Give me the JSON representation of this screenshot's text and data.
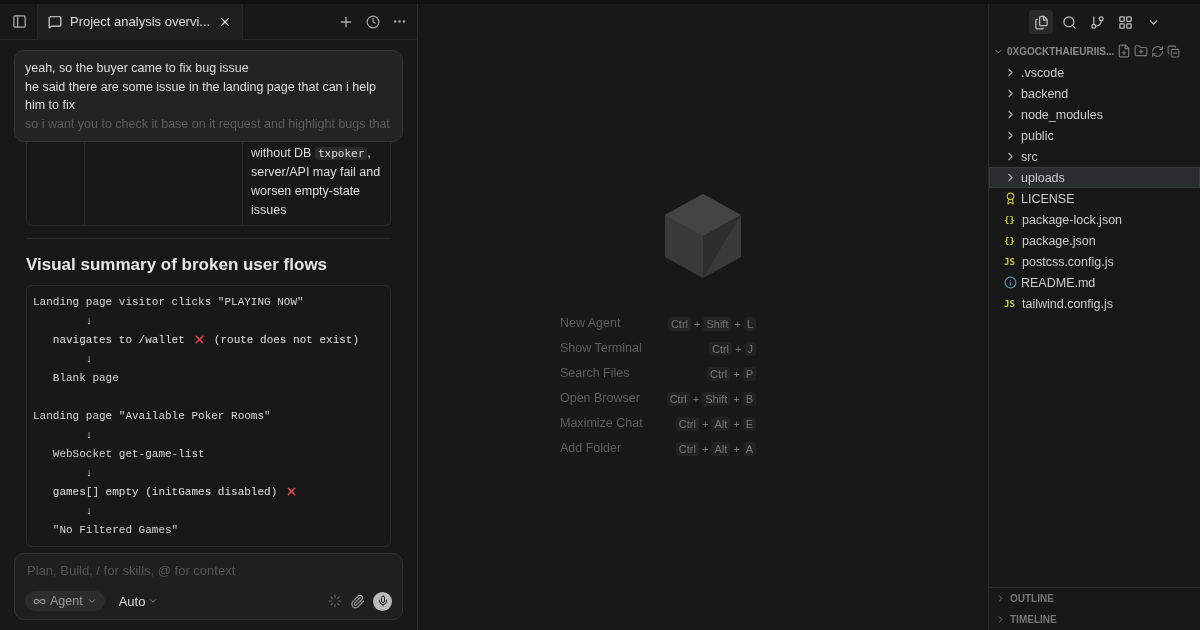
{
  "chat_tab": {
    "title": "Project analysis overvi..."
  },
  "user_message": {
    "lines": [
      "yeah, so the buyer came to fix bug issue",
      "he said there are some issue in the landing page that can i help him to fix",
      "so i want you to check it base on it request and highlight bugs that"
    ]
  },
  "table_fragment": {
    "cell_before": "without DB",
    "code": "txpoker",
    "cell_after": ", server/API may fail and worsen empty-state issues"
  },
  "section_heading": "Visual summary of broken user flows",
  "code_block": {
    "lines": [
      {
        "text": "Landing page visitor clicks \"PLAYING NOW\"",
        "error": false
      },
      {
        "text": "        ↓",
        "error": false
      },
      {
        "text": "   navigates to /wallet",
        "error": true,
        "note": "(route does not exist)"
      },
      {
        "text": "        ↓",
        "error": false
      },
      {
        "text": "   Blank page",
        "error": false
      },
      {
        "error": false
      },
      {
        "text": "Landing page \"Available Poker Rooms\"",
        "error": false
      },
      {
        "text": "        ↓",
        "error": false
      },
      {
        "text": "   WebSocket get-game-list",
        "error": false
      },
      {
        "text": "        ↓",
        "error": false
      },
      {
        "text": "   games[] empty (initGames disabled)",
        "error": true
      },
      {
        "text": "        ↓",
        "error": false
      },
      {
        "text": "   \"No Filtered Games\"",
        "error": false
      }
    ]
  },
  "composer": {
    "placeholder": "Plan, Build, / for skills, @ for context",
    "mode": "Agent",
    "model": "Auto"
  },
  "shortcuts": [
    {
      "label": "New Agent",
      "keys": [
        {
          "kind": "key",
          "text": "Ctrl"
        },
        {
          "kind": "plus",
          "text": "+"
        },
        {
          "kind": "key",
          "text": "Shift"
        },
        {
          "kind": "plus",
          "text": "+"
        },
        {
          "kind": "key",
          "text": "L"
        }
      ]
    },
    {
      "label": "Show Terminal",
      "keys": [
        {
          "kind": "key",
          "text": "Ctrl"
        },
        {
          "kind": "plus",
          "text": "+"
        },
        {
          "kind": "key",
          "text": "J"
        }
      ]
    },
    {
      "label": "Search Files",
      "keys": [
        {
          "kind": "key",
          "text": "Ctrl"
        },
        {
          "kind": "plus",
          "text": "+"
        },
        {
          "kind": "key",
          "text": "P"
        }
      ]
    },
    {
      "label": "Open Browser",
      "keys": [
        {
          "kind": "key",
          "text": "Ctrl"
        },
        {
          "kind": "plus",
          "text": "+"
        },
        {
          "kind": "key",
          "text": "Shift"
        },
        {
          "kind": "plus",
          "text": "+"
        },
        {
          "kind": "key",
          "text": "B"
        }
      ]
    },
    {
      "label": "Maximize Chat",
      "keys": [
        {
          "kind": "key",
          "text": "Ctrl"
        },
        {
          "kind": "plus",
          "text": "+"
        },
        {
          "kind": "key",
          "text": "Alt"
        },
        {
          "kind": "plus",
          "text": "+"
        },
        {
          "kind": "key",
          "text": "E"
        }
      ]
    },
    {
      "label": "Add Folder",
      "keys": [
        {
          "kind": "key",
          "text": "Ctrl"
        },
        {
          "kind": "plus",
          "text": "+"
        },
        {
          "kind": "key",
          "text": "Alt"
        },
        {
          "kind": "plus",
          "text": "+"
        },
        {
          "kind": "key",
          "text": "A"
        }
      ]
    }
  ],
  "explorer": {
    "root": "0XGOCKTHAIEURIIS...",
    "items": [
      {
        "name": ".vscode",
        "kind": "folder",
        "selected": false
      },
      {
        "name": "backend",
        "kind": "folder",
        "selected": false
      },
      {
        "name": "node_modules",
        "kind": "folder",
        "selected": false
      },
      {
        "name": "public",
        "kind": "folder",
        "selected": false
      },
      {
        "name": "src",
        "kind": "folder",
        "selected": false
      },
      {
        "name": "uploads",
        "kind": "folder",
        "selected": true
      },
      {
        "name": "LICENSE",
        "kind": "license",
        "selected": false
      },
      {
        "name": "package-lock.json",
        "kind": "json",
        "icon_text": "{}",
        "selected": false
      },
      {
        "name": "package.json",
        "kind": "json",
        "icon_text": "{}",
        "selected": false
      },
      {
        "name": "postcss.config.js",
        "kind": "js",
        "icon_text": "JS",
        "selected": false
      },
      {
        "name": "README.md",
        "kind": "info",
        "selected": false
      },
      {
        "name": "tailwind.config.js",
        "kind": "js",
        "icon_text": "JS",
        "selected": false
      }
    ],
    "sections": [
      "OUTLINE",
      "TIMELINE"
    ]
  }
}
